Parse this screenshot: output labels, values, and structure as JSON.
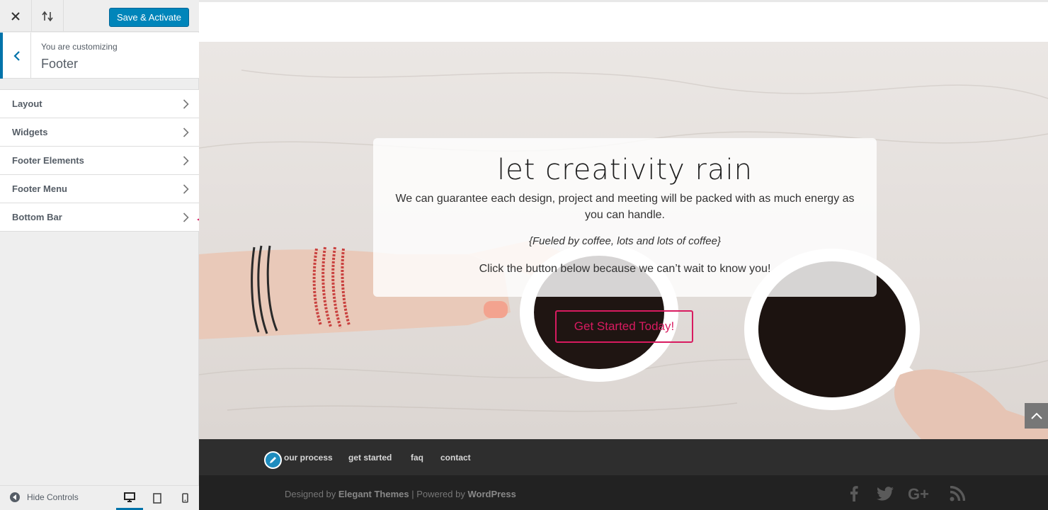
{
  "sidebar": {
    "save_label": "Save & Activate",
    "customizing_label": "You are customizing",
    "section_title": "Footer",
    "items": [
      {
        "label": "Layout"
      },
      {
        "label": "Widgets"
      },
      {
        "label": "Footer Elements"
      },
      {
        "label": "Footer Menu"
      },
      {
        "label": "Bottom Bar"
      }
    ],
    "hide_controls_label": "Hide Controls",
    "active_device": "desktop",
    "annotation_arrow_color": "#d81b60"
  },
  "preview": {
    "hero": {
      "title": "let creativity rain",
      "paragraph": "We can guarantee each design, project and meeting will be packed with as much energy as you can handle.",
      "tagline": "{Fueled by coffee, lots and lots of coffee}",
      "prompt": "Click the button below because we can’t wait to know you!",
      "cta_label": "Get Started Today!"
    },
    "footer_menu": [
      "our process",
      "get started",
      "faq",
      "contact"
    ],
    "credits": {
      "prefix": "Designed by ",
      "theme": "Elegant Themes",
      "separator": " | Powered by ",
      "platform": "WordPress"
    },
    "social_icons": [
      "facebook-icon",
      "twitter-icon",
      "google-plus-icon",
      "rss-icon"
    ]
  },
  "colors": {
    "accent": "#0085ba",
    "cta": "#d81b60",
    "footer_nav_bg": "#2e2e2e",
    "footer_bottom_bg": "#222222"
  }
}
